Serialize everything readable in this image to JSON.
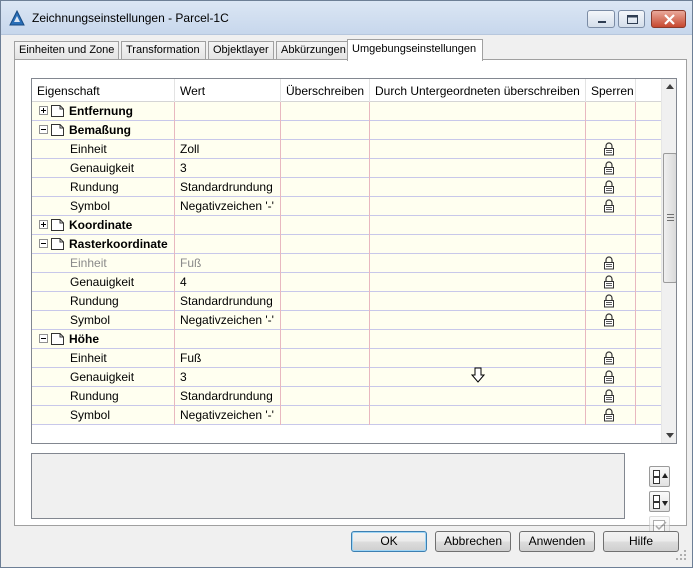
{
  "window": {
    "title": "Zeichnungseinstellungen - Parcel-1C"
  },
  "tabs": [
    {
      "label": "Einheiten und Zone"
    },
    {
      "label": "Transformation"
    },
    {
      "label": "Objektlayer"
    },
    {
      "label": "Abkürzungen"
    },
    {
      "label": "Umgebungseinstellungen"
    }
  ],
  "grid": {
    "columns": {
      "property": "Eigenschaft",
      "value": "Wert",
      "override": "Überschreiben",
      "child_override": "Durch Untergeordneten überschreiben",
      "lock": "Sperren"
    },
    "rows": [
      {
        "kind": "group",
        "label": "Entfernung",
        "expanded": false
      },
      {
        "kind": "group",
        "label": "Bemaßung",
        "expanded": true
      },
      {
        "kind": "item",
        "label": "Einheit",
        "value": "Zoll",
        "locked": true,
        "disabled": false
      },
      {
        "kind": "item",
        "label": "Genauigkeit",
        "value": "3",
        "locked": true,
        "disabled": false
      },
      {
        "kind": "item",
        "label": "Rundung",
        "value": "Standardrundung",
        "locked": true,
        "disabled": false
      },
      {
        "kind": "item",
        "label": "Symbol",
        "value": "Negativzeichen '-'",
        "locked": true,
        "disabled": false
      },
      {
        "kind": "group",
        "label": "Koordinate",
        "expanded": false
      },
      {
        "kind": "group",
        "label": "Rasterkoordinate",
        "expanded": true
      },
      {
        "kind": "item",
        "label": "Einheit",
        "value": "Fuß",
        "locked": true,
        "disabled": true
      },
      {
        "kind": "item",
        "label": "Genauigkeit",
        "value": "4",
        "locked": true,
        "disabled": false
      },
      {
        "kind": "item",
        "label": "Rundung",
        "value": "Standardrundung",
        "locked": true,
        "disabled": false
      },
      {
        "kind": "item",
        "label": "Symbol",
        "value": "Negativzeichen '-'",
        "locked": true,
        "disabled": false
      },
      {
        "kind": "group",
        "label": "Höhe",
        "expanded": true
      },
      {
        "kind": "item",
        "label": "Einheit",
        "value": "Fuß",
        "locked": true,
        "disabled": false
      },
      {
        "kind": "item",
        "label": "Genauigkeit",
        "value": "3",
        "locked": true,
        "disabled": false
      },
      {
        "kind": "item",
        "label": "Rundung",
        "value": "Standardrundung",
        "locked": true,
        "disabled": false
      },
      {
        "kind": "item",
        "label": "Symbol",
        "value": "Negativzeichen '-'",
        "locked": true,
        "disabled": false
      }
    ]
  },
  "buttons": {
    "ok": "OK",
    "cancel": "Abbrechen",
    "apply": "Anwenden",
    "help": "Hilfe"
  },
  "icons": {
    "app": "autocad-civil-icon",
    "lock": "padlock-icon",
    "group": "document-icon"
  },
  "colors": {
    "row_background": "#fffff0",
    "row_separator": "#c8c8ea",
    "column_separator": "#e8b8c0"
  }
}
